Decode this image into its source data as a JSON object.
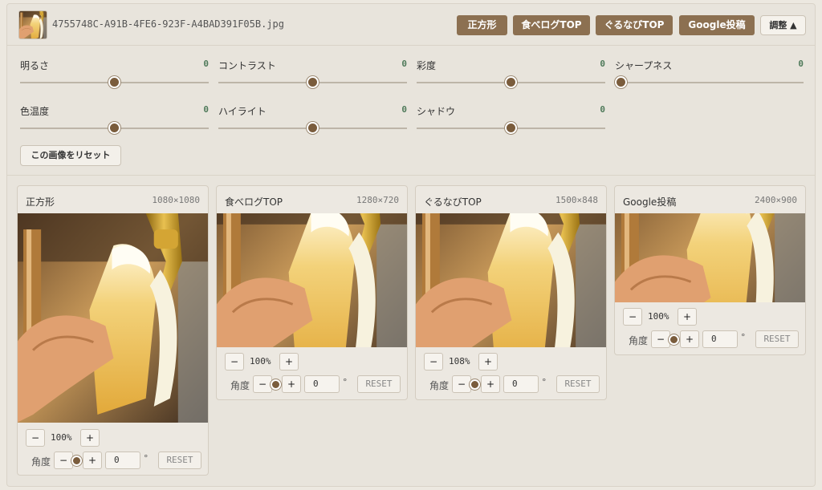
{
  "header": {
    "filename": "4755748C-A91B-4FE6-923F-A4BAD391F05B.jpg",
    "presets": [
      "正方形",
      "食べログTOP",
      "ぐるなびTOP",
      "Google投稿"
    ],
    "adjust_label": "調整 ▲"
  },
  "adjust": {
    "sliders": [
      {
        "label": "明るさ",
        "value": "0",
        "position": 0.5
      },
      {
        "label": "コントラスト",
        "value": "0",
        "position": 0.5
      },
      {
        "label": "彩度",
        "value": "0",
        "position": 0.5
      },
      {
        "label": "シャープネス",
        "value": "0",
        "position": 0.0
      },
      {
        "label": "色温度",
        "value": "0",
        "position": 0.5
      },
      {
        "label": "ハイライト",
        "value": "0",
        "position": 0.5
      },
      {
        "label": "シャドウ",
        "value": "0",
        "position": 0.5
      }
    ],
    "reset_label": "この画像をリセット"
  },
  "cards": [
    {
      "title": "正方形",
      "size": "1080×1080",
      "zoom": "100%",
      "angle_label": "角度",
      "angle": "0",
      "deg": "°",
      "reset": "RESET",
      "minus": "−",
      "plus": "+"
    },
    {
      "title": "食べログTOP",
      "size": "1280×720",
      "zoom": "100%",
      "angle_label": "角度",
      "angle": "0",
      "deg": "°",
      "reset": "RESET",
      "minus": "−",
      "plus": "+"
    },
    {
      "title": "ぐるなびTOP",
      "size": "1500×848",
      "zoom": "108%",
      "angle_label": "角度",
      "angle": "0",
      "deg": "°",
      "reset": "RESET",
      "minus": "−",
      "plus": "+"
    },
    {
      "title": "Google投稿",
      "size": "2400×900",
      "zoom": "100%",
      "angle_label": "角度",
      "angle": "0",
      "deg": "°",
      "reset": "RESET",
      "minus": "−",
      "plus": "+"
    }
  ],
  "colors": {
    "accent": "#8c7051",
    "knob": "#7a5c3c",
    "value_green": "#4f7a5a"
  }
}
